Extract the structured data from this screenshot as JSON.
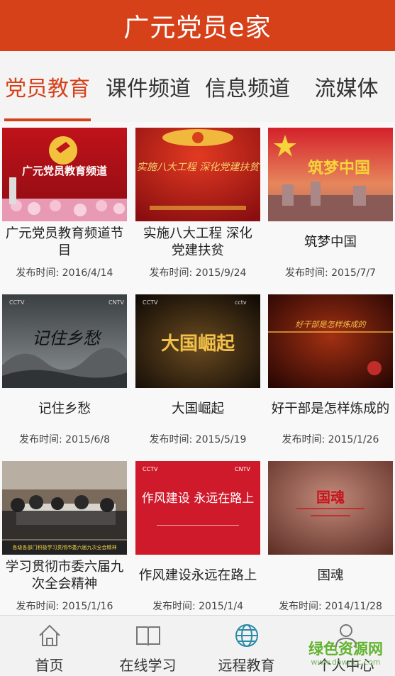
{
  "app": {
    "title": "广元党员e家",
    "accent": "#d6411a"
  },
  "tabs": [
    {
      "label": "党员教育",
      "active": true
    },
    {
      "label": "课件频道",
      "active": false
    },
    {
      "label": "信息频道",
      "active": false
    },
    {
      "label": "流媒体",
      "active": false
    }
  ],
  "programs": [
    {
      "title": "广元党员教育频道节目",
      "date": "发布时间: 2016/4/14",
      "thumb_text": "广元党员教育频道"
    },
    {
      "title": "实施八大工程 深化党建扶贫",
      "date": "发布时间: 2015/9/24",
      "thumb_text": "实施八大工程 深化党建扶贫"
    },
    {
      "title": "筑梦中国",
      "date": "发布时间: 2015/7/7",
      "thumb_text": "筑梦中国"
    },
    {
      "title": "记住乡愁",
      "date": "发布时间: 2015/6/8",
      "thumb_text": "记住乡愁"
    },
    {
      "title": "大国崛起",
      "date": "发布时间: 2015/5/19",
      "thumb_text": "大国崛起"
    },
    {
      "title": "好干部是怎样炼成的",
      "date": "发布时间: 2015/1/26",
      "thumb_text": "好干部是怎样炼成的"
    },
    {
      "title": "学习贯彻市委六届九次全会精神",
      "date": "发布时间: 2015/1/16",
      "thumb_text": "各级各部门积极学习贯彻市委六届九次全会精神"
    },
    {
      "title": "作风建设永远在路上",
      "date": "发布时间: 2015/1/4",
      "thumb_text": "作风建设 永远在路上"
    },
    {
      "title": "国魂",
      "date": "发布时间: 2014/11/28",
      "thumb_text": "国魂"
    }
  ],
  "bottom_nav": [
    {
      "label": "首页",
      "icon": "home-icon"
    },
    {
      "label": "在线学习",
      "icon": "book-icon"
    },
    {
      "label": "远程教育",
      "icon": "globe-icon"
    },
    {
      "label": "个人中心",
      "icon": "user-icon"
    }
  ],
  "watermark": {
    "text": "绿色资源网",
    "url": "www.downcc.com"
  }
}
